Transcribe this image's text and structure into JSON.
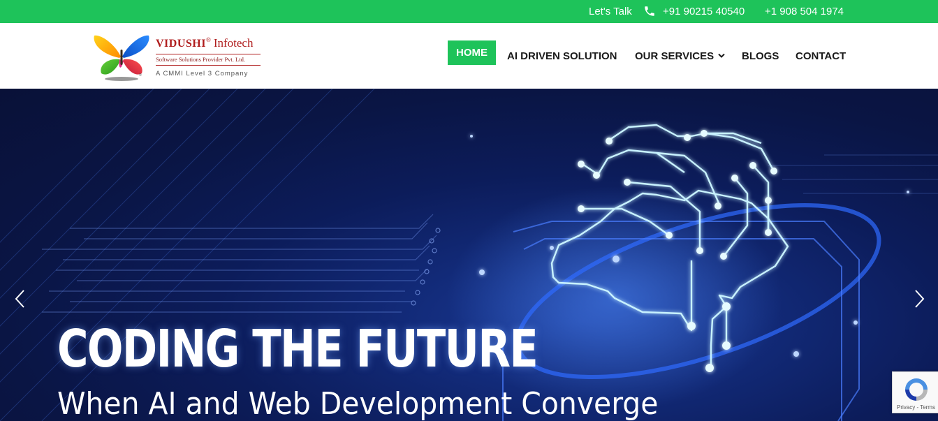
{
  "topbar": {
    "lets_talk": "Let's Talk",
    "phone_icon": "phone-icon",
    "phone_primary": "+91 90215 40540",
    "phone_secondary": "+1 908 504 1974",
    "background_color": "#1ec35a"
  },
  "logo": {
    "brand_name": "VIDUSHI",
    "registered_mark": "®",
    "brand_suffix": "Infotech",
    "tagline": "Software Solutions Provider Pvt. Ltd.",
    "certification": "A CMMI Level 3 Company",
    "icon": "butterfly-logo-icon"
  },
  "nav": {
    "items": [
      {
        "label": "HOME",
        "active": true
      },
      {
        "label": "AI DRIVEN SOLUTION",
        "active": false
      },
      {
        "label": "OUR SERVICES",
        "active": false,
        "has_dropdown": true
      },
      {
        "label": "BLOGS",
        "active": false
      },
      {
        "label": "CONTACT",
        "active": false
      }
    ],
    "active_color": "#1ec35a"
  },
  "hero": {
    "title": "CODING THE FUTURE",
    "subtitle": "When AI and Web Development Converge",
    "prev_icon": "chevron-left-icon",
    "next_icon": "chevron-right-icon",
    "illustration": "circuit-brain-illustration"
  },
  "recaptcha": {
    "links": "Privacy - Terms",
    "icon": "recaptcha-icon"
  }
}
